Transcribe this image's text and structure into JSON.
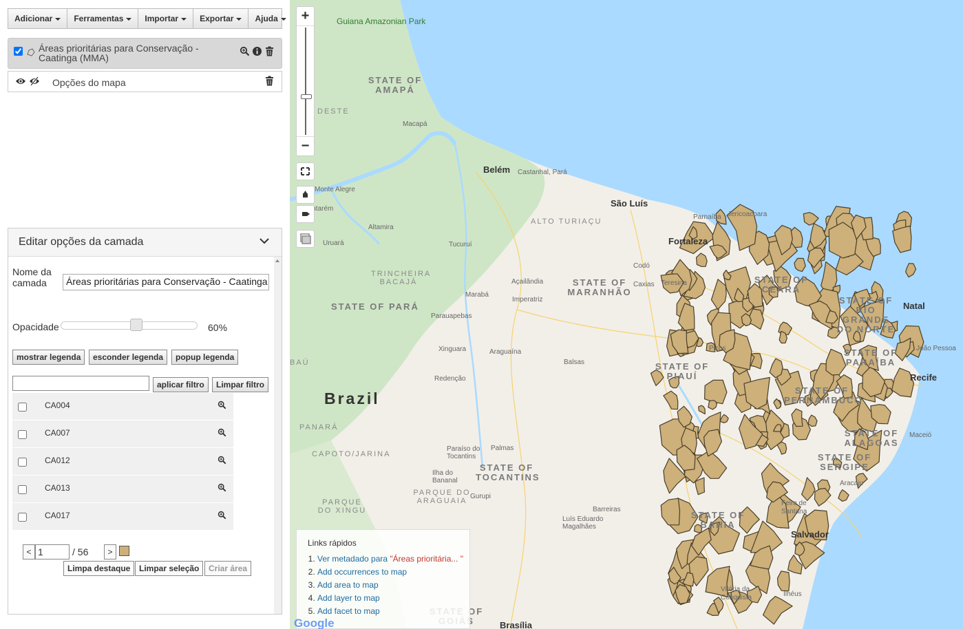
{
  "menu": [
    {
      "label": "Adicionar"
    },
    {
      "label": "Ferramentas"
    },
    {
      "label": "Importar"
    },
    {
      "label": "Exportar"
    },
    {
      "label": "Ajuda"
    }
  ],
  "layer": {
    "name": "Áreas prioritárias para Conservação - Caatinga (MMA)",
    "checked": true
  },
  "map_options": {
    "label": "Opções do mapa"
  },
  "edit_panel": {
    "title": "Editar opções da camada",
    "name_label": "Nome da camada",
    "name_value": "Áreas prioritárias para Conservação - Caatinga (MMA)",
    "opacity_label": "Opacidade",
    "opacity_value": "60%",
    "opacity": 0.6,
    "legend_buttons": {
      "show": "mostrar legenda",
      "hide": "esconder legenda",
      "popup": "popup legenda"
    },
    "filter_apply": "aplicar filtro",
    "filter_clear": "Limpar filtro",
    "filter_value": "",
    "items": [
      {
        "code": "CA004"
      },
      {
        "code": "CA007"
      },
      {
        "code": "CA012"
      },
      {
        "code": "CA013"
      },
      {
        "code": "CA017"
      }
    ],
    "pager": {
      "prev": "<",
      "next": ">",
      "page": "1",
      "total": "/ 56"
    },
    "actions": {
      "clear_highlight": "Limpa destaque",
      "clear_selection": "Limpar seleção",
      "create_area": "Criar área"
    },
    "swatch_color": "#cdb07a"
  },
  "map": {
    "zoom_in": "+",
    "zoom_out": "−",
    "country": "Brazil",
    "states": [
      {
        "name": "STATE OF AMAPÁ"
      },
      {
        "name": "STATE OF PARÁ"
      },
      {
        "name": "STATE OF MARANHÃO"
      },
      {
        "name": "STATE OF PIAUÍ"
      },
      {
        "name": "STATE OF TOCANTINS"
      },
      {
        "name": "STATE OF CEARÁ"
      },
      {
        "name": "STATE OF RIO GRANDE DO NORTE"
      },
      {
        "name": "STATE OF PARAÍBA"
      },
      {
        "name": "STATE OF PERNAMBUCO"
      },
      {
        "name": "STATE OF ALAGOAS"
      },
      {
        "name": "STATE OF SERGIPE"
      },
      {
        "name": "STATE OF BAHIA"
      },
      {
        "name": "STATE OF GOIÁS"
      }
    ],
    "regions": [
      {
        "name": "DESTE"
      },
      {
        "name": "TRINCHEIRA BACAJÁ"
      },
      {
        "name": "ALTO TURIAÇU"
      },
      {
        "name": "PANARÁ"
      },
      {
        "name": "CAPOTO/JARINA"
      },
      {
        "name": "PARQUE DO XINGU"
      },
      {
        "name": "PARQUE DO ARAGUAIA"
      },
      {
        "name": "BAÚ"
      }
    ],
    "park": "Guiana Amazonian Park",
    "big_cities": [
      {
        "name": "Belém"
      },
      {
        "name": "São Luís"
      },
      {
        "name": "Fortaleza"
      },
      {
        "name": "Natal"
      },
      {
        "name": "Recife"
      },
      {
        "name": "Salvador"
      },
      {
        "name": "Brasília"
      }
    ],
    "cities": [
      {
        "name": "Macapá"
      },
      {
        "name": "Castanhal, Pará"
      },
      {
        "name": "Monte Alegre"
      },
      {
        "name": "Santarém"
      },
      {
        "name": "Altamira"
      },
      {
        "name": "Uruará"
      },
      {
        "name": "Tucuruí"
      },
      {
        "name": "Marabá"
      },
      {
        "name": "Açailândia"
      },
      {
        "name": "Imperatriz"
      },
      {
        "name": "Parauapebas"
      },
      {
        "name": "Xinguara"
      },
      {
        "name": "Araguaína"
      },
      {
        "name": "Balsas"
      },
      {
        "name": "Redenção"
      },
      {
        "name": "Paraíso do Tocantins"
      },
      {
        "name": "Palmas"
      },
      {
        "name": "Ilha do Bananal"
      },
      {
        "name": "Gurupi"
      },
      {
        "name": "Barreiras"
      },
      {
        "name": "Luís Eduardo Magalhães"
      },
      {
        "name": "Codó"
      },
      {
        "name": "Caxias"
      },
      {
        "name": "Teresina"
      },
      {
        "name": "Parnaíba"
      },
      {
        "name": "Jericoacoara"
      },
      {
        "name": "Picos"
      },
      {
        "name": "João Pessoa"
      },
      {
        "name": "Maceió"
      },
      {
        "name": "Aracaju"
      },
      {
        "name": "Feira de Santana"
      },
      {
        "name": "Vitória da Conquista"
      },
      {
        "name": "Ilhéus"
      }
    ],
    "quick_links": {
      "title": "Links rápidos",
      "items": [
        {
          "prefix": "Ver metadado para ",
          "highlight": "\"Áreas prioritária... \""
        },
        {
          "text": "Add occurrences to map"
        },
        {
          "text": "Add area to map"
        },
        {
          "text": "Add layer to map"
        },
        {
          "text": "Add facet to map"
        }
      ]
    },
    "attribution": "Google",
    "colors": {
      "sea": "#aadaff",
      "land": "#f2efe9",
      "forest": "#cfe6c6",
      "priority": "#cdb07a",
      "outline": "#4a3f2a"
    }
  }
}
